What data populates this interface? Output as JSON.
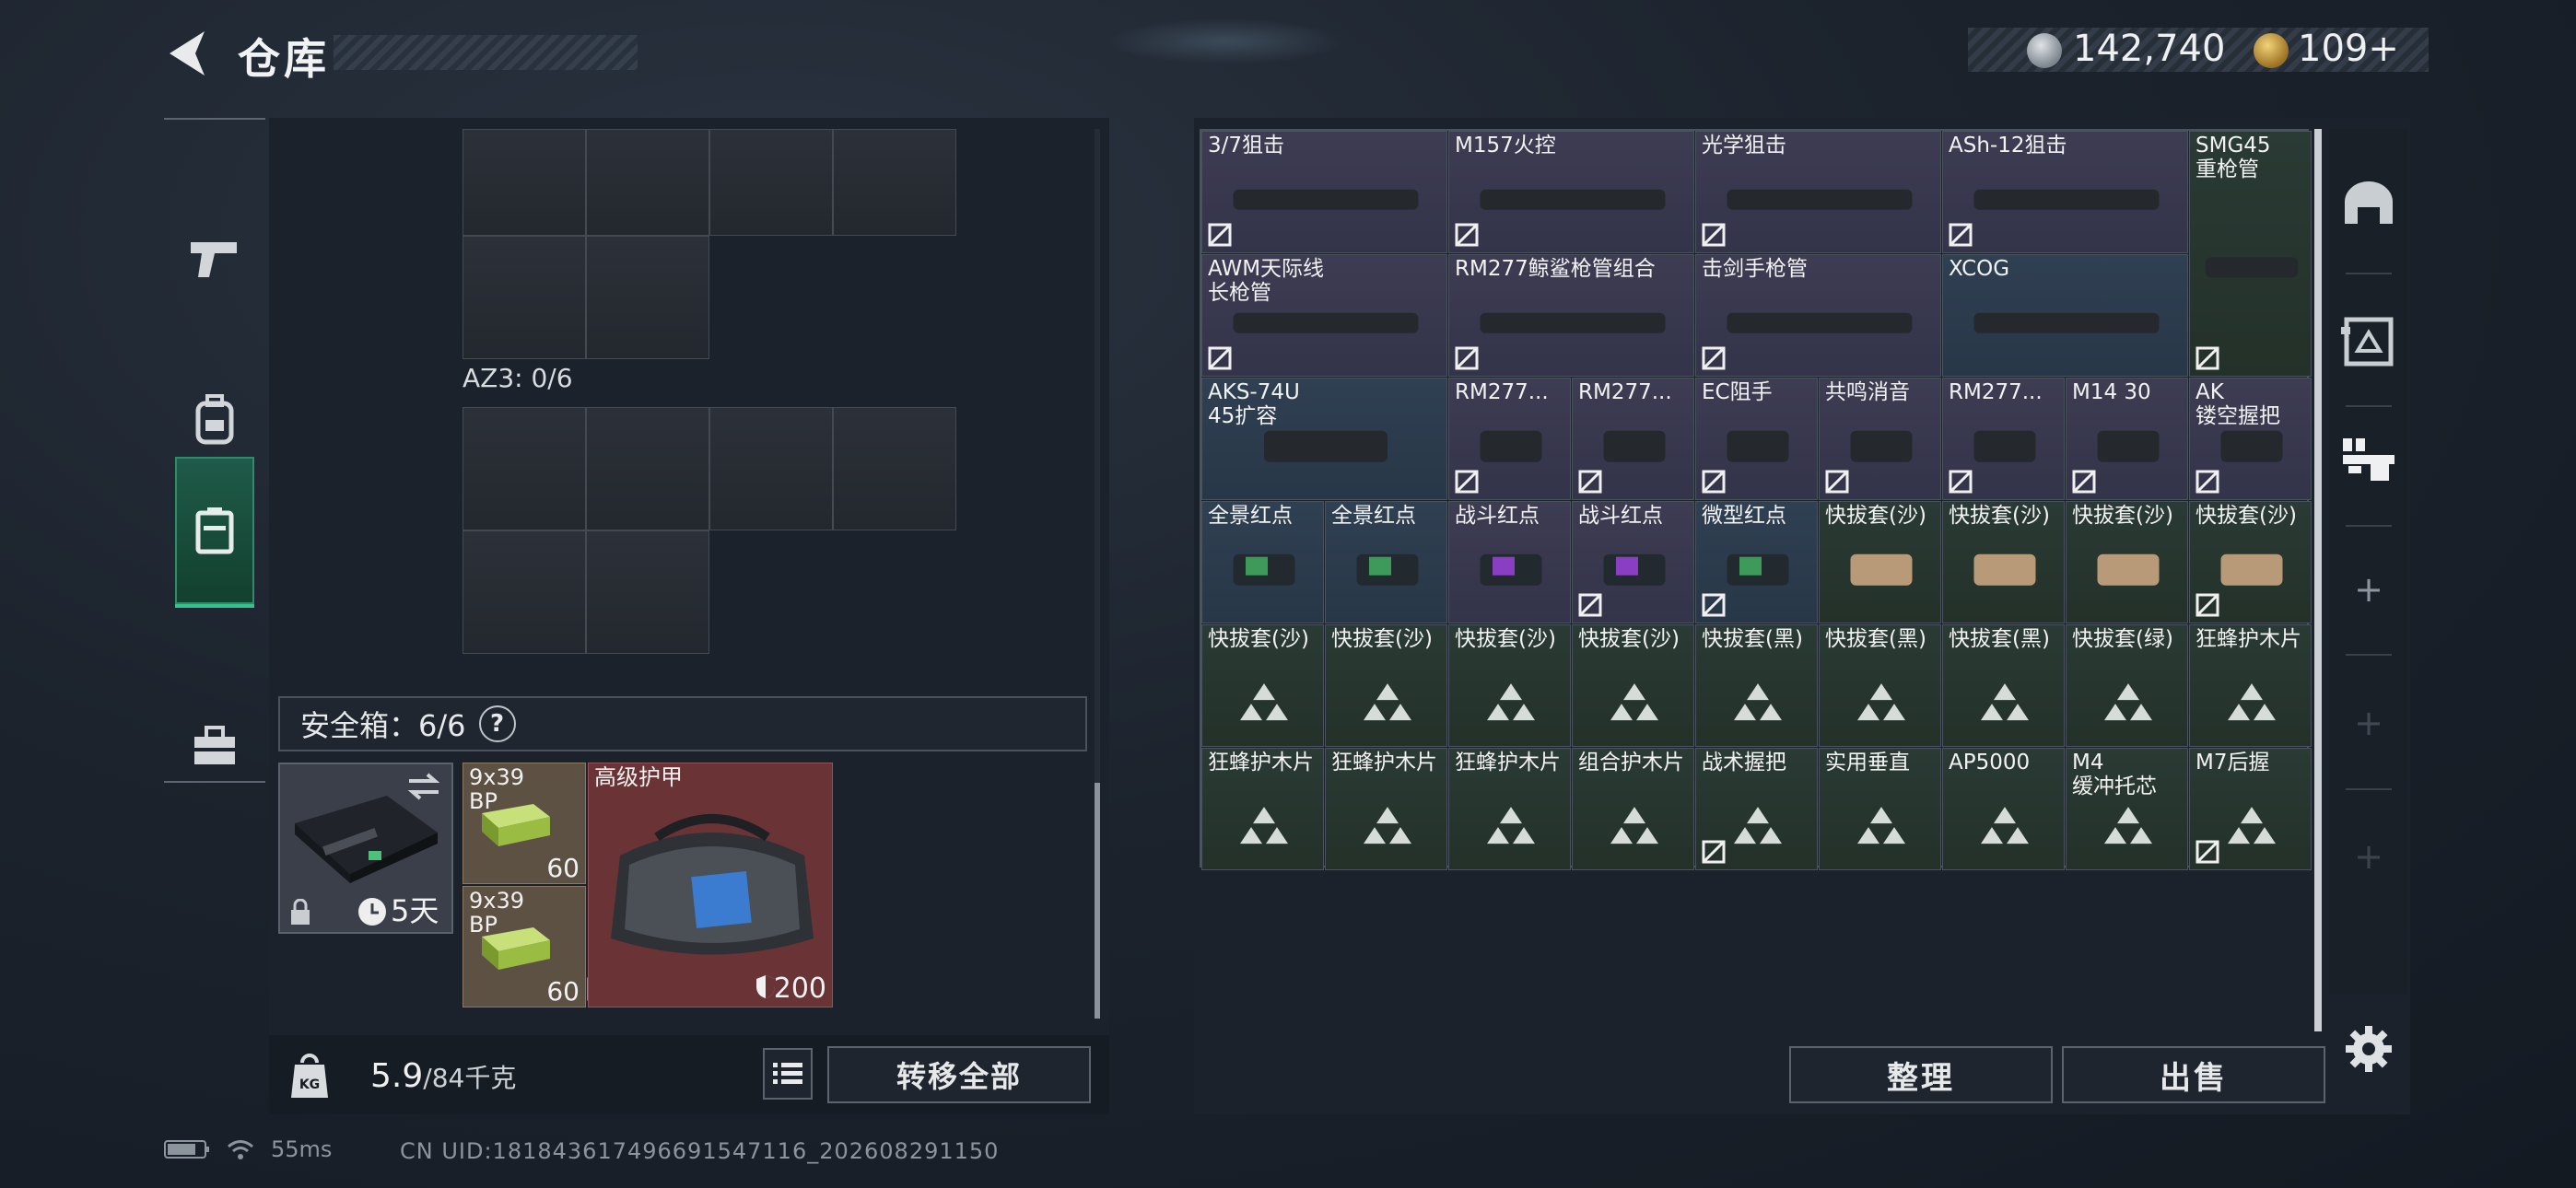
{
  "header": {
    "title": "仓库",
    "silver": "142,740",
    "gold": "109",
    "gold_suffix": "+"
  },
  "left_nav": [
    "pistol-icon",
    "backpack-icon",
    "case-icon",
    "toolbox-icon"
  ],
  "container": {
    "label": "AZ3: 0/6"
  },
  "safebox": {
    "label": "安全箱：6/6",
    "help": "?",
    "duration": "5天"
  },
  "safe_items": [
    {
      "name": "9x39\nBP",
      "count": "60"
    },
    {
      "name": "9x39\nBP",
      "count": "60"
    },
    {
      "name": "高级护甲",
      "durability": "200"
    }
  ],
  "weight": {
    "current": "5.9",
    "max": "/84千克"
  },
  "buttons": {
    "transfer": "转移全部",
    "sort": "整理",
    "sell": "出售"
  },
  "items": [
    {
      "label": "3/7狙击",
      "color": "purple",
      "lock": true
    },
    {
      "label": "M157火控",
      "color": "purple",
      "lock": true
    },
    {
      "label": "光学狙击",
      "color": "purple",
      "lock": true
    },
    {
      "label": "ASh-12狙击",
      "color": "purple",
      "lock": true
    },
    {
      "label": "SMG45\n重枪管",
      "color": "green",
      "lock": true
    },
    {
      "label": "AWM天际线\n长枪管",
      "color": "purple",
      "lock": true
    },
    {
      "label": "RM277鲸鲨枪管组合",
      "color": "purple",
      "lock": true
    },
    {
      "label": "击剑手枪管",
      "color": "purple",
      "lock": true
    },
    {
      "label": "XCOG",
      "color": "blue",
      "lock": false
    },
    {
      "label": "AKS-74U\n45扩容",
      "color": "blue",
      "lock": false
    },
    {
      "label": "RM277...",
      "color": "purple",
      "lock": true
    },
    {
      "label": "RM277...",
      "color": "purple",
      "lock": true
    },
    {
      "label": "EC阻手",
      "color": "purple",
      "lock": true
    },
    {
      "label": "共鸣消音",
      "color": "purple",
      "lock": true
    },
    {
      "label": "RM277...",
      "color": "purple",
      "lock": true
    },
    {
      "label": "M14 30",
      "color": "purple",
      "lock": true
    },
    {
      "label": "AK\n镂空握把",
      "color": "purple",
      "lock": true
    },
    {
      "label": "全景红点",
      "color": "blue",
      "lock": false
    },
    {
      "label": "全景红点",
      "color": "blue",
      "lock": false
    },
    {
      "label": "战斗红点",
      "color": "purple",
      "lock": false
    },
    {
      "label": "战斗红点",
      "color": "purple",
      "lock": true
    },
    {
      "label": "微型红点",
      "color": "blue",
      "lock": true
    },
    {
      "label": "快拔套(沙)",
      "color": "green",
      "lock": false
    },
    {
      "label": "快拔套(沙)",
      "color": "green",
      "lock": false
    },
    {
      "label": "快拔套(沙)",
      "color": "green",
      "lock": false
    },
    {
      "label": "快拔套(沙)",
      "color": "green",
      "lock": true
    },
    {
      "label": "快拔套(沙)",
      "color": "green",
      "lock": false
    },
    {
      "label": "快拔套(沙)",
      "color": "green",
      "lock": false
    },
    {
      "label": "快拔套(沙)",
      "color": "green",
      "lock": false
    },
    {
      "label": "快拔套(沙)",
      "color": "green",
      "lock": false
    },
    {
      "label": "快拔套(黑)",
      "color": "green",
      "lock": false
    },
    {
      "label": "快拔套(黑)",
      "color": "green",
      "lock": false
    },
    {
      "label": "快拔套(黑)",
      "color": "green",
      "lock": false
    },
    {
      "label": "快拔套(绿)",
      "color": "green",
      "lock": false
    },
    {
      "label": "狂蜂护木片",
      "color": "green",
      "lock": false
    },
    {
      "label": "狂蜂护木片",
      "color": "green",
      "lock": false
    },
    {
      "label": "狂蜂护木片",
      "color": "green",
      "lock": false
    },
    {
      "label": "狂蜂护木片",
      "color": "green",
      "lock": false
    },
    {
      "label": "组合护木片",
      "color": "green",
      "lock": false
    },
    {
      "label": "战术握把",
      "color": "green",
      "lock": true
    },
    {
      "label": "实用垂直",
      "color": "green",
      "lock": false
    },
    {
      "label": "AP5000",
      "color": "green",
      "lock": false
    },
    {
      "label": "M4\n缓冲托芯",
      "color": "green",
      "lock": false
    },
    {
      "label": "M7后握",
      "color": "green",
      "lock": true
    }
  ],
  "status": {
    "ping": "55ms",
    "uid": "CN UID:181843617496691547116_202608291150"
  },
  "colors": {
    "accent_green": "#36c08b",
    "purple_rarity": "#3d3c52",
    "blue_rarity": "#2f4052",
    "green_rarity": "#2a3a34"
  }
}
